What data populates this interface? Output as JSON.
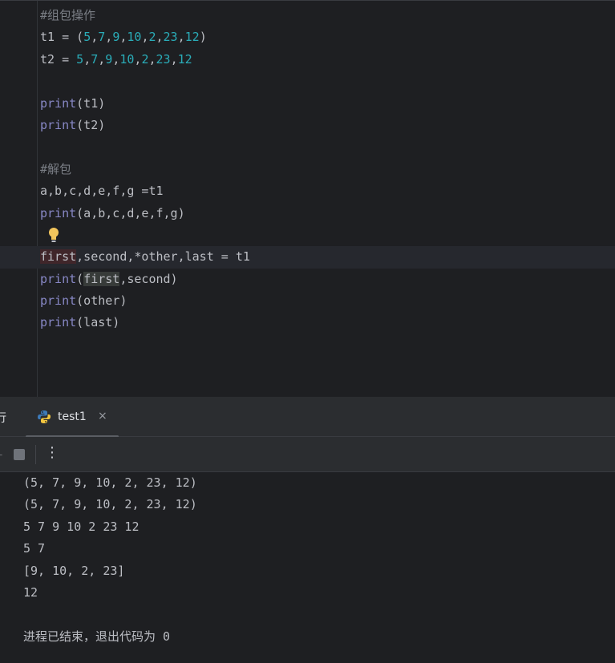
{
  "editor": {
    "lines": [
      {
        "type": "comment",
        "text": "#组包操作"
      },
      {
        "type": "tokens",
        "tokens": [
          {
            "t": "t1 = (",
            "c": ""
          },
          {
            "t": "5",
            "c": "num"
          },
          {
            "t": ",",
            "c": ""
          },
          {
            "t": "7",
            "c": "num"
          },
          {
            "t": ",",
            "c": ""
          },
          {
            "t": "9",
            "c": "num"
          },
          {
            "t": ",",
            "c": ""
          },
          {
            "t": "10",
            "c": "num"
          },
          {
            "t": ",",
            "c": ""
          },
          {
            "t": "2",
            "c": "num"
          },
          {
            "t": ",",
            "c": ""
          },
          {
            "t": "23",
            "c": "num"
          },
          {
            "t": ",",
            "c": ""
          },
          {
            "t": "12",
            "c": "num"
          },
          {
            "t": ")",
            "c": ""
          }
        ]
      },
      {
        "type": "tokens",
        "tokens": [
          {
            "t": "t2 = ",
            "c": ""
          },
          {
            "t": "5",
            "c": "num"
          },
          {
            "t": ",",
            "c": ""
          },
          {
            "t": "7",
            "c": "num"
          },
          {
            "t": ",",
            "c": ""
          },
          {
            "t": "9",
            "c": "num"
          },
          {
            "t": ",",
            "c": ""
          },
          {
            "t": "10",
            "c": "num"
          },
          {
            "t": ",",
            "c": ""
          },
          {
            "t": "2",
            "c": "num"
          },
          {
            "t": ",",
            "c": ""
          },
          {
            "t": "23",
            "c": "num"
          },
          {
            "t": ",",
            "c": ""
          },
          {
            "t": "12",
            "c": "num"
          }
        ]
      },
      {
        "type": "blank"
      },
      {
        "type": "tokens",
        "tokens": [
          {
            "t": "print",
            "c": "kw"
          },
          {
            "t": "(t1)",
            "c": ""
          }
        ]
      },
      {
        "type": "tokens",
        "tokens": [
          {
            "t": "print",
            "c": "kw"
          },
          {
            "t": "(t2)",
            "c": ""
          }
        ]
      },
      {
        "type": "blank"
      },
      {
        "type": "comment",
        "text": "#解包"
      },
      {
        "type": "tokens",
        "tokens": [
          {
            "t": "a,b,c,d,e,f,g =t1",
            "c": ""
          }
        ]
      },
      {
        "type": "tokens",
        "tokens": [
          {
            "t": "print",
            "c": "kw"
          },
          {
            "t": "(a,b,c,d,e,f,g)",
            "c": ""
          }
        ]
      },
      {
        "type": "bulb"
      },
      {
        "type": "tokens",
        "current": true,
        "tokens": [
          {
            "t": "first",
            "c": "hl-def"
          },
          {
            "t": ",second,*other,last = t1",
            "c": ""
          }
        ]
      },
      {
        "type": "tokens",
        "tokens": [
          {
            "t": "print",
            "c": "kw"
          },
          {
            "t": "(",
            "c": ""
          },
          {
            "t": "first",
            "c": "hl-use"
          },
          {
            "t": ",second)",
            "c": ""
          }
        ]
      },
      {
        "type": "tokens",
        "tokens": [
          {
            "t": "print",
            "c": "kw"
          },
          {
            "t": "(other)",
            "c": ""
          }
        ]
      },
      {
        "type": "tokens",
        "tokens": [
          {
            "t": "print",
            "c": "kw"
          },
          {
            "t": "(last)",
            "c": ""
          }
        ]
      }
    ],
    "colors": {
      "keyword": "#8888c6",
      "number": "#2aacb8",
      "comment": "#7a7e85"
    }
  },
  "tool_window": {
    "title": "行",
    "run_tab": {
      "label": "test1",
      "close": "×",
      "icon": "python-icon"
    },
    "toolbar": {
      "partial_icon": "⌞",
      "stop_icon": "stop-icon",
      "more": "⋮"
    }
  },
  "console": {
    "lines": [
      "(5, 7, 9, 10, 2, 23, 12)",
      "(5, 7, 9, 10, 2, 23, 12)",
      "5 7 9 10 2 23 12",
      "5 7",
      "[9, 10, 2, 23]",
      "12",
      "",
      "进程已结束，退出代码为 0"
    ]
  }
}
